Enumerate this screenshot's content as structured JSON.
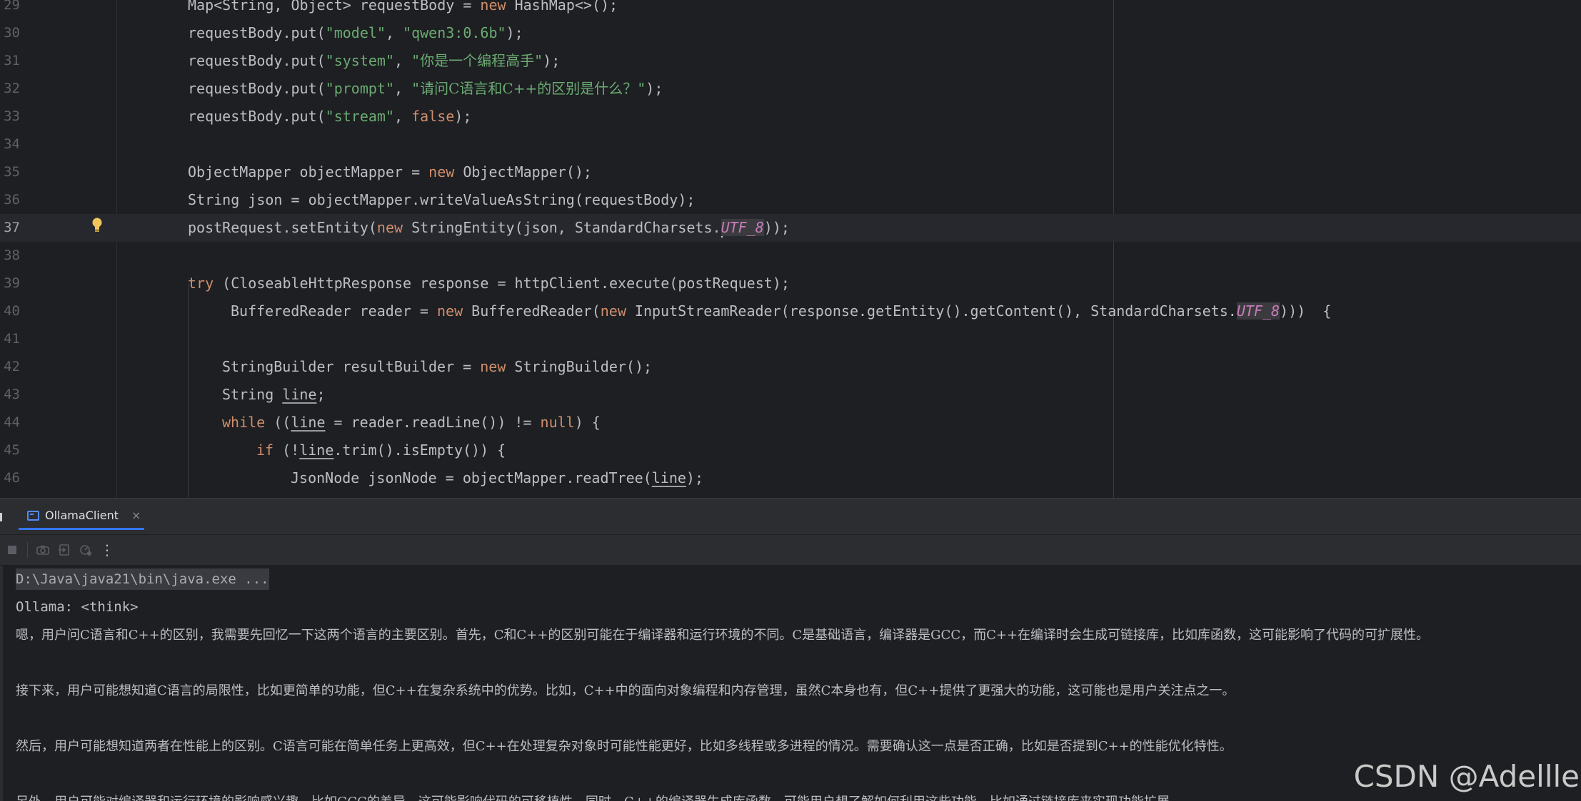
{
  "editor": {
    "lines": [
      {
        "num": "29",
        "segments": [
          [
            "p",
            "Map<String, Object> requestBody = "
          ],
          [
            "k",
            "new"
          ],
          [
            "p",
            " HashMap<>();"
          ]
        ]
      },
      {
        "num": "30",
        "segments": [
          [
            "p",
            "requestBody.put("
          ],
          [
            "s",
            "\"model\""
          ],
          [
            "p",
            ", "
          ],
          [
            "s",
            "\"qwen3:0.6b\""
          ],
          [
            "p",
            ");"
          ]
        ]
      },
      {
        "num": "31",
        "segments": [
          [
            "p",
            "requestBody.put("
          ],
          [
            "s",
            "\"system\""
          ],
          [
            "p",
            ", "
          ],
          [
            "s",
            "\""
          ],
          [
            "sc",
            "你是一个编程高手"
          ],
          [
            "s",
            "\""
          ],
          [
            "p",
            ");"
          ]
        ]
      },
      {
        "num": "32",
        "segments": [
          [
            "p",
            "requestBody.put("
          ],
          [
            "s",
            "\"prompt\""
          ],
          [
            "p",
            ", "
          ],
          [
            "s",
            "\""
          ],
          [
            "sc",
            "请问C语言和C++的区别是什么？"
          ],
          [
            "s",
            "\""
          ],
          [
            "p",
            ");"
          ]
        ]
      },
      {
        "num": "33",
        "segments": [
          [
            "p",
            "requestBody.put("
          ],
          [
            "s",
            "\"stream\""
          ],
          [
            "p",
            ", "
          ],
          [
            "k",
            "false"
          ],
          [
            "p",
            ");"
          ]
        ]
      },
      {
        "num": "34",
        "segments": []
      },
      {
        "num": "35",
        "segments": [
          [
            "p",
            "ObjectMapper objectMapper = "
          ],
          [
            "k",
            "new"
          ],
          [
            "p",
            " ObjectMapper();"
          ]
        ]
      },
      {
        "num": "36",
        "segments": [
          [
            "p",
            "String json = objectMapper.writeValueAsString(requestBody);"
          ]
        ]
      },
      {
        "num": "37",
        "segments": [
          [
            "p",
            "postRequest.setEntity("
          ],
          [
            "k",
            "new"
          ],
          [
            "p",
            " StringEntity(json, StandardCharsets."
          ],
          [
            "caret",
            ""
          ],
          [
            "fh",
            "UTF_8"
          ],
          [
            "p",
            "));"
          ]
        ]
      },
      {
        "num": "38",
        "segments": []
      },
      {
        "num": "39",
        "segments": [
          [
            "k",
            "try"
          ],
          [
            "p",
            " (CloseableHttpResponse response = httpClient.execute(postRequest);"
          ]
        ]
      },
      {
        "num": "40",
        "segments": [
          [
            "p",
            "BufferedReader reader = "
          ],
          [
            "k",
            "new"
          ],
          [
            "p",
            " BufferedReader("
          ],
          [
            "k",
            "new"
          ],
          [
            "p",
            " InputStreamReader(response.getEntity().getContent(), StandardCharsets."
          ],
          [
            "fh",
            "UTF_8"
          ],
          [
            "p",
            ")))  {"
          ]
        ]
      },
      {
        "num": "41",
        "segments": []
      },
      {
        "num": "42",
        "segments": [
          [
            "p",
            "StringBuilder resultBuilder = "
          ],
          [
            "k",
            "new"
          ],
          [
            "p",
            " StringBuilder();"
          ]
        ]
      },
      {
        "num": "43",
        "segments": [
          [
            "p",
            "String "
          ],
          [
            "u",
            "line"
          ],
          [
            "p",
            ";"
          ]
        ]
      },
      {
        "num": "44",
        "segments": [
          [
            "k",
            "while"
          ],
          [
            "p",
            " (("
          ],
          [
            "u",
            "line"
          ],
          [
            "p",
            " = reader.readLine()) != "
          ],
          [
            "k",
            "null"
          ],
          [
            "p",
            ") {"
          ]
        ]
      },
      {
        "num": "45",
        "segments": [
          [
            "k",
            "if"
          ],
          [
            "p",
            " (!"
          ],
          [
            "u",
            "line"
          ],
          [
            "p",
            ".trim().isEmpty()) {"
          ]
        ]
      },
      {
        "num": "46",
        "segments": [
          [
            "p",
            "JsonNode jsonNode = objectMapper.readTree("
          ],
          [
            "u",
            "line"
          ],
          [
            "p",
            ");"
          ]
        ]
      }
    ]
  },
  "run_panel": {
    "tab_label": "OllamaClient",
    "close_glyph": "×",
    "toolbar_icons": [
      "stop-icon",
      "camera-icon",
      "export-icon",
      "restart-icon",
      "more-icon"
    ]
  },
  "console": {
    "command": "D:\\Java\\java21\\bin\\java.exe ...",
    "lines": [
      "Ollama: <think>",
      "嗯，用户问C语言和C++的区别，我需要先回忆一下这两个语言的主要区别。首先，C和C++的区别可能在于编译器和运行环境的不同。C是基础语言，编译器是GCC，而C++在编译时会生成可链接库，比如库函数，这可能影响了代码的可扩展性。",
      "",
      "接下来，用户可能想知道C语言的局限性，比如更简单的功能，但C++在复杂系统中的优势。比如，C++中的面向对象编程和内存管理，虽然C本身也有，但C++提供了更强大的功能，这可能也是用户关注点之一。",
      "",
      "然后，用户可能想知道两者在性能上的区别。C语言可能在简单任务上更高效，但C++在处理复杂对象时可能性能更好，比如多线程或多进程的情况。需要确认这一点是否正确，比如是否提到C++的性能优化特性。",
      "",
      "另外，用户可能对编译器和运行环境的影响感兴趣，比如GCC的差异，这可能影响代码的可移植性。同时，C++的编译器生成库函数，可能用户想了解如何利用这些功能，比如通过链接库来实现功能扩展。"
    ]
  },
  "watermark": "CSDN @Adellle"
}
